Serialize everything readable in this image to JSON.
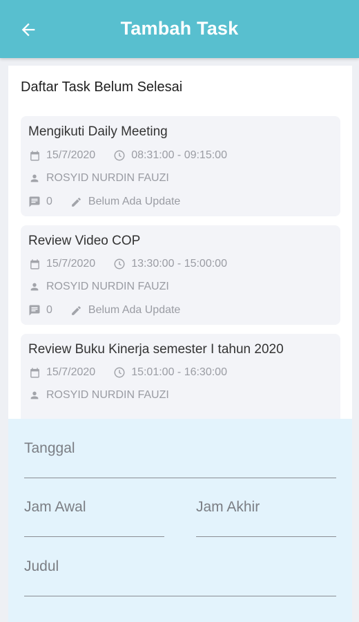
{
  "appbar": {
    "title": "Tambah Task",
    "background": "#58bfcf"
  },
  "task_list": {
    "title": "Daftar Task Belum Selesai",
    "items": [
      {
        "title": "Mengikuti Daily Meeting",
        "date": "15/7/2020",
        "time": "08:31:00 - 09:15:00",
        "person": "ROSYID NURDIN FAUZI",
        "comments": "0",
        "update": "Belum Ada Update"
      },
      {
        "title": "Review Video COP",
        "date": "15/7/2020",
        "time": "13:30:00 - 15:00:00",
        "person": "ROSYID NURDIN FAUZI",
        "comments": "0",
        "update": "Belum Ada Update"
      },
      {
        "title": "Review Buku Kinerja semester I tahun 2020",
        "date": "15/7/2020",
        "time": "15:01:00 - 16:30:00",
        "person": "ROSYID NURDIN FAUZI"
      }
    ]
  },
  "form": {
    "tanggal_label": "Tanggal",
    "jam_awal_label": "Jam Awal",
    "jam_akhir_label": "Jam Akhir",
    "judul_label": "Judul",
    "background": "#e3f3fc"
  }
}
